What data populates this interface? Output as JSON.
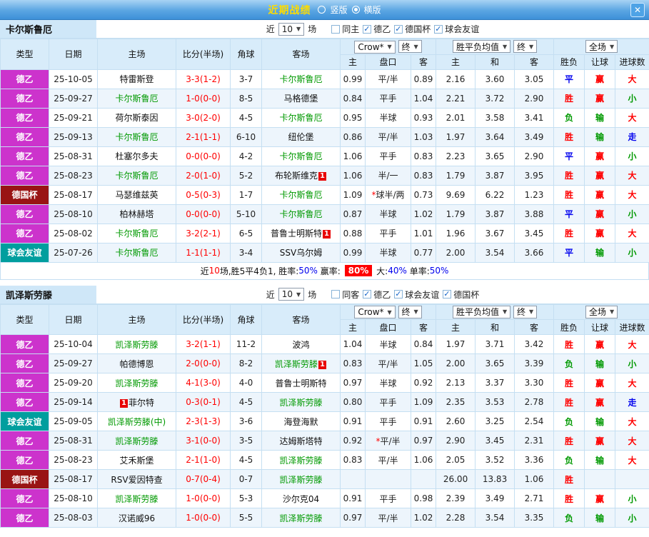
{
  "titlebar": {
    "title": "近期战绩",
    "radios": [
      {
        "label": "竖版",
        "selected": false
      },
      {
        "label": "横版",
        "selected": true
      }
    ],
    "close": "✕"
  },
  "near_label": "近",
  "matches_label": "场",
  "columns": {
    "type": "类型",
    "date": "日期",
    "home": "主场",
    "score": "比分(半场)",
    "corners": "角球",
    "away": "客场",
    "odds_source": "Crow*",
    "final": "终",
    "eu_mean": "胜平负均值",
    "full": "全场",
    "h": "主",
    "handicap": "盘口",
    "a": "客",
    "draw": "和",
    "wl": "胜负",
    "let_ball": "让球",
    "goals": "进球数"
  },
  "sections": [
    {
      "team": "卡尔斯鲁厄",
      "count": "10",
      "filters": [
        {
          "label": "同主",
          "checked": false
        },
        {
          "label": "德乙",
          "checked": true
        },
        {
          "label": "德国杯",
          "checked": true
        },
        {
          "label": "球会友谊",
          "checked": true
        }
      ],
      "rows": [
        {
          "type": "德乙",
          "date": "25-10-05",
          "home": "特雷斯登",
          "score": "3-3(1-2)",
          "corners": "3-7",
          "away": "卡尔斯鲁厄",
          "odds_home": "0.99",
          "handicap": "平/半",
          "odds_away": "0.89",
          "eu_home": "2.16",
          "eu_draw": "3.60",
          "eu_away": "3.05",
          "result": "平",
          "let": "赢",
          "goals": "大"
        },
        {
          "type": "德乙",
          "date": "25-09-27",
          "home": "卡尔斯鲁厄",
          "score": "1-0(0-0)",
          "corners": "8-5",
          "away": "马格德堡",
          "odds_home": "0.84",
          "handicap": "平手",
          "odds_away": "1.04",
          "eu_home": "2.21",
          "eu_draw": "3.72",
          "eu_away": "2.90",
          "result": "胜",
          "let": "赢",
          "goals": "小"
        },
        {
          "type": "德乙",
          "date": "25-09-21",
          "home": "荷尔斯泰因",
          "score": "3-0(2-0)",
          "corners": "4-5",
          "away": "卡尔斯鲁厄",
          "odds_home": "0.95",
          "handicap": "半球",
          "odds_away": "0.93",
          "eu_home": "2.01",
          "eu_draw": "3.58",
          "eu_away": "3.41",
          "result": "负",
          "let": "输",
          "goals": "大"
        },
        {
          "type": "德乙",
          "date": "25-09-13",
          "home": "卡尔斯鲁厄",
          "score": "2-1(1-1)",
          "corners": "6-10",
          "away": "纽伦堡",
          "odds_home": "0.86",
          "handicap": "平/半",
          "odds_away": "1.03",
          "eu_home": "1.97",
          "eu_draw": "3.64",
          "eu_away": "3.49",
          "result": "胜",
          "let": "输",
          "goals": "走"
        },
        {
          "type": "德乙",
          "date": "25-08-31",
          "home": "杜塞尔多夫",
          "score": "0-0(0-0)",
          "corners": "4-2",
          "away": "卡尔斯鲁厄",
          "odds_home": "1.06",
          "handicap": "平手",
          "odds_away": "0.83",
          "eu_home": "2.23",
          "eu_draw": "3.65",
          "eu_away": "2.90",
          "result": "平",
          "let": "赢",
          "goals": "小"
        },
        {
          "type": "德乙",
          "date": "25-08-23",
          "home": "卡尔斯鲁厄",
          "score": "2-0(1-0)",
          "corners": "5-2",
          "away": "布轮斯维克",
          "away_badge": "1",
          "odds_home": "1.06",
          "handicap": "半/一",
          "odds_away": "0.83",
          "eu_home": "1.79",
          "eu_draw": "3.87",
          "eu_away": "3.95",
          "result": "胜",
          "let": "赢",
          "goals": "大"
        },
        {
          "type": "德国杯",
          "date": "25-08-17",
          "home": "马瑟维兹英",
          "score": "0-5(0-3)",
          "corners": "1-7",
          "away": "卡尔斯鲁厄",
          "odds_home": "1.09",
          "handicap": "*球半/两",
          "odds_away": "0.73",
          "eu_home": "9.69",
          "eu_draw": "6.22",
          "eu_away": "1.23",
          "result": "胜",
          "let": "赢",
          "goals": "大"
        },
        {
          "type": "德乙",
          "date": "25-08-10",
          "home": "柏林赫塔",
          "score": "0-0(0-0)",
          "corners": "5-10",
          "away": "卡尔斯鲁厄",
          "odds_home": "0.87",
          "handicap": "半球",
          "odds_away": "1.02",
          "eu_home": "1.79",
          "eu_draw": "3.87",
          "eu_away": "3.88",
          "result": "平",
          "let": "赢",
          "goals": "小"
        },
        {
          "type": "德乙",
          "date": "25-08-02",
          "home": "卡尔斯鲁厄",
          "score": "3-2(2-1)",
          "corners": "6-5",
          "away": "普鲁士明斯特",
          "away_badge": "1",
          "odds_home": "0.88",
          "handicap": "平手",
          "odds_away": "1.01",
          "eu_home": "1.96",
          "eu_draw": "3.67",
          "eu_away": "3.45",
          "result": "胜",
          "let": "赢",
          "goals": "大"
        },
        {
          "type": "球会友谊",
          "date": "25-07-26",
          "home": "卡尔斯鲁厄",
          "score": "1-1(1-1)",
          "corners": "3-4",
          "away": "SSV乌尔姆",
          "odds_home": "0.99",
          "handicap": "半球",
          "odds_away": "0.77",
          "eu_home": "2.00",
          "eu_draw": "3.54",
          "eu_away": "3.66",
          "result": "平",
          "let": "输",
          "goals": "小"
        }
      ],
      "summary": [
        {
          "text": "近",
          "style": "plain"
        },
        {
          "text": "10",
          "style": "red"
        },
        {
          "text": "场,胜5平4负1, 胜率:",
          "style": "plain"
        },
        {
          "text": "50%",
          "style": "blue"
        },
        {
          "text": " 赢率: ",
          "style": "plain"
        },
        {
          "text": "80%",
          "style": "redbg"
        },
        {
          "text": " 大:",
          "style": "plain"
        },
        {
          "text": "40%",
          "style": "blue"
        },
        {
          "text": " 单率:",
          "style": "plain"
        },
        {
          "text": "50%",
          "style": "blue"
        }
      ]
    },
    {
      "team": "凯泽斯劳滕",
      "count": "10",
      "filters": [
        {
          "label": "同客",
          "checked": false
        },
        {
          "label": "德乙",
          "checked": true
        },
        {
          "label": "球会友谊",
          "checked": true
        },
        {
          "label": "德国杯",
          "checked": true
        }
      ],
      "rows": [
        {
          "type": "德乙",
          "date": "25-10-04",
          "home": "凯泽斯劳滕",
          "score": "3-2(1-1)",
          "corners": "11-2",
          "away": "波鸿",
          "odds_home": "1.04",
          "handicap": "半球",
          "odds_away": "0.84",
          "eu_home": "1.97",
          "eu_draw": "3.71",
          "eu_away": "3.42",
          "result": "胜",
          "let": "赢",
          "goals": "大"
        },
        {
          "type": "德乙",
          "date": "25-09-27",
          "home": "帕德博恩",
          "score": "2-0(0-0)",
          "corners": "8-2",
          "away": "凯泽斯劳滕",
          "away_badge": "1",
          "odds_home": "0.83",
          "handicap": "平/半",
          "odds_away": "1.05",
          "eu_home": "2.00",
          "eu_draw": "3.65",
          "eu_away": "3.39",
          "result": "负",
          "let": "输",
          "goals": "小"
        },
        {
          "type": "德乙",
          "date": "25-09-20",
          "home": "凯泽斯劳滕",
          "score": "4-1(3-0)",
          "corners": "4-0",
          "away": "普鲁士明斯特",
          "odds_home": "0.97",
          "handicap": "半球",
          "odds_away": "0.92",
          "eu_home": "2.13",
          "eu_draw": "3.37",
          "eu_away": "3.30",
          "result": "胜",
          "let": "赢",
          "goals": "大"
        },
        {
          "type": "德乙",
          "date": "25-09-14",
          "home": "菲尔特",
          "home_badge": "1",
          "home_badge_pos": "before",
          "score": "0-3(0-1)",
          "corners": "4-5",
          "away": "凯泽斯劳滕",
          "odds_home": "0.80",
          "handicap": "平手",
          "odds_away": "1.09",
          "eu_home": "2.35",
          "eu_draw": "3.53",
          "eu_away": "2.78",
          "result": "胜",
          "let": "赢",
          "goals": "走"
        },
        {
          "type": "球会友谊",
          "date": "25-09-05",
          "home": "凯泽斯劳滕(中)",
          "score": "2-3(1-3)",
          "corners": "3-6",
          "away": "海登海默",
          "odds_home": "0.91",
          "handicap": "平手",
          "odds_away": "0.91",
          "eu_home": "2.60",
          "eu_draw": "3.25",
          "eu_away": "2.54",
          "result": "负",
          "let": "输",
          "goals": "大"
        },
        {
          "type": "德乙",
          "date": "25-08-31",
          "home": "凯泽斯劳滕",
          "score": "3-1(0-0)",
          "corners": "3-5",
          "away": "达姆斯塔特",
          "odds_home": "0.92",
          "handicap": "*平/半",
          "odds_away": "0.97",
          "eu_home": "2.90",
          "eu_draw": "3.45",
          "eu_away": "2.31",
          "result": "胜",
          "let": "赢",
          "goals": "大"
        },
        {
          "type": "德乙",
          "date": "25-08-23",
          "home": "艾禾斯堡",
          "score": "2-1(1-0)",
          "corners": "4-5",
          "away": "凯泽斯劳滕",
          "odds_home": "0.83",
          "handicap": "平/半",
          "odds_away": "1.06",
          "eu_home": "2.05",
          "eu_draw": "3.52",
          "eu_away": "3.36",
          "result": "负",
          "let": "输",
          "goals": "大"
        },
        {
          "type": "德国杯",
          "date": "25-08-17",
          "home": "RSV爱因特查",
          "score": "0-7(0-4)",
          "corners": "0-7",
          "away": "凯泽斯劳滕",
          "odds_home": "",
          "handicap": "",
          "odds_away": "",
          "eu_home": "26.00",
          "eu_draw": "13.83",
          "eu_away": "1.06",
          "result": "胜",
          "let": "",
          "goals": ""
        },
        {
          "type": "德乙",
          "date": "25-08-10",
          "home": "凯泽斯劳滕",
          "score": "1-0(0-0)",
          "corners": "5-3",
          "away": "沙尔克04",
          "odds_home": "0.91",
          "handicap": "平手",
          "odds_away": "0.98",
          "eu_home": "2.39",
          "eu_draw": "3.49",
          "eu_away": "2.71",
          "result": "胜",
          "let": "赢",
          "goals": "小"
        },
        {
          "type": "德乙",
          "date": "25-08-03",
          "home": "汉诺威96",
          "score": "1-0(0-0)",
          "corners": "5-5",
          "away": "凯泽斯劳滕",
          "odds_home": "0.97",
          "handicap": "平/半",
          "odds_away": "1.02",
          "eu_home": "2.28",
          "eu_draw": "3.54",
          "eu_away": "3.35",
          "result": "负",
          "let": "输",
          "goals": "小"
        }
      ]
    }
  ]
}
